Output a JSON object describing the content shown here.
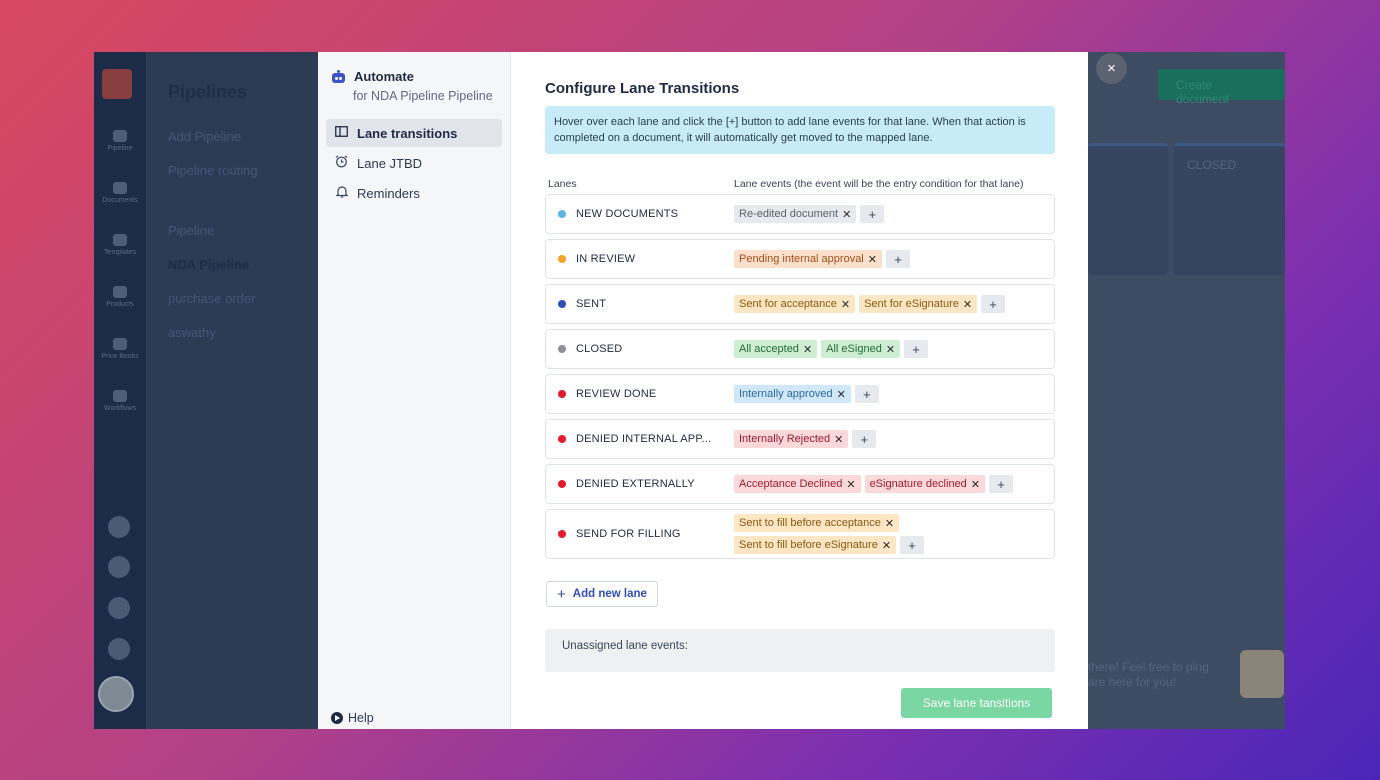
{
  "background_app": {
    "panel_title": "Pipelines",
    "panel_items": [
      {
        "label": "Add Pipeline"
      },
      {
        "label": "Pipeline routing"
      },
      {
        "label": "Pipeline"
      },
      {
        "label": "NDA Pipeline"
      },
      {
        "label": "purchase order"
      },
      {
        "label": "aswathy"
      }
    ],
    "rail_items": [
      "Pipeline",
      "Documents",
      "Templates",
      "Products",
      "Price Books",
      "Workflows"
    ],
    "create_document_label": "Create document",
    "closed_lane_label": "CLOSED",
    "chat_text_line1": "there! Feel free to ping",
    "chat_text_line2": "are here for you!"
  },
  "sidebar": {
    "title": "Automate",
    "subtitle": "for NDA Pipeline Pipeline",
    "items": [
      {
        "label": "Lane transitions",
        "icon": "columns-icon",
        "active": true
      },
      {
        "label": "Lane JTBD",
        "icon": "alarm-clock-icon",
        "active": false
      },
      {
        "label": "Reminders",
        "icon": "bell-icon",
        "active": false
      }
    ],
    "help_label": "Help"
  },
  "main": {
    "title": "Configure Lane Transitions",
    "info": "Hover over each lane and click the [+] button to add lane events for that lane. When that action is completed on a document, it will automatically get moved to the mapped lane.",
    "col_lanes": "Lanes",
    "col_events": "Lane events (the event will be the entry condition for that lane)",
    "add_lane_label": "Add new lane",
    "unassigned_label": "Unassigned lane events:",
    "save_label": "Save lane tansitions"
  },
  "lanes": [
    {
      "name": "NEW DOCUMENTS",
      "color": "#5bb6e8",
      "events": [
        {
          "label": "Re-edited document",
          "style": "gray"
        }
      ]
    },
    {
      "name": "IN REVIEW",
      "color": "#f5a623",
      "events": [
        {
          "label": "Pending internal approval",
          "style": "orange"
        }
      ]
    },
    {
      "name": "SENT",
      "color": "#2f4ec1",
      "events": [
        {
          "label": "Sent for acceptance",
          "style": "peach"
        },
        {
          "label": "Sent for eSignature",
          "style": "peach"
        }
      ]
    },
    {
      "name": "CLOSED",
      "color": "#8a8f98",
      "events": [
        {
          "label": "All accepted",
          "style": "green"
        },
        {
          "label": "All eSigned",
          "style": "green"
        }
      ]
    },
    {
      "name": "REVIEW DONE",
      "color": "#e8192c",
      "events": [
        {
          "label": "Internally approved",
          "style": "blue"
        }
      ]
    },
    {
      "name": "DENIED INTERNAL APP...",
      "color": "#e8192c",
      "events": [
        {
          "label": "Internally Rejected",
          "style": "red"
        }
      ]
    },
    {
      "name": "DENIED EXTERNALLY",
      "color": "#e8192c",
      "events": [
        {
          "label": "Acceptance Declined",
          "style": "red"
        },
        {
          "label": "eSignature declined",
          "style": "red"
        }
      ]
    },
    {
      "name": "SEND FOR FILLING",
      "color": "#e8192c",
      "events": [
        {
          "label": "Sent to fill before acceptance",
          "style": "peach"
        },
        {
          "label": "Sent to fill before eSignature",
          "style": "peach"
        }
      ]
    }
  ],
  "close_label": "×"
}
